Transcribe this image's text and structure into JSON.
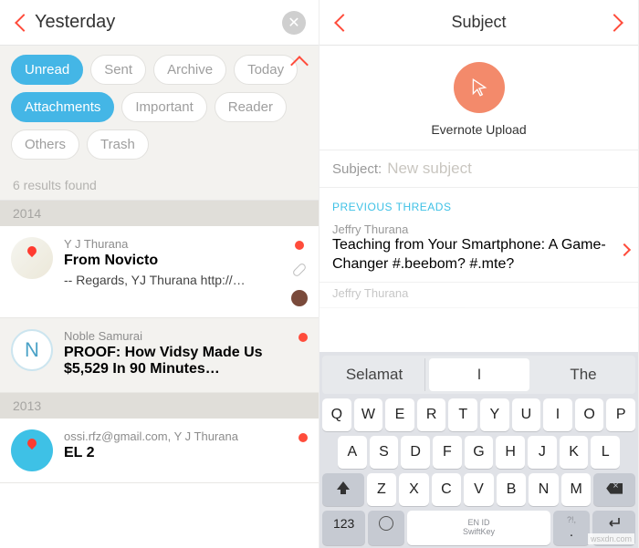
{
  "left": {
    "title": "Yesterday",
    "filters": [
      {
        "label": "Unread",
        "active": true
      },
      {
        "label": "Sent",
        "active": false
      },
      {
        "label": "Archive",
        "active": false
      },
      {
        "label": "Today",
        "active": false
      },
      {
        "label": "Attachments",
        "active": true
      },
      {
        "label": "Important",
        "active": false
      },
      {
        "label": "Reader",
        "active": false
      },
      {
        "label": "Others",
        "active": false
      },
      {
        "label": "Trash",
        "active": false
      }
    ],
    "results_text": "6 results found",
    "year1": "2014",
    "items": [
      {
        "sender": "Y J Thurana",
        "subject": "From Novicto",
        "preview": "-- Regards, YJ Thurana http://…"
      },
      {
        "sender": "Noble Samurai",
        "subject": "PROOF: How Vidsy Made Us $5,529 In 90 Minutes…",
        "preview": ""
      }
    ],
    "year2": "2013",
    "item3": {
      "sender": "ossi.rfz@gmail.com, Y J Thurana",
      "subject": "EL 2"
    }
  },
  "right": {
    "title": "Subject",
    "upload_label": "Evernote Upload",
    "subject_key": "Subject:",
    "subject_placeholder": "New subject",
    "section": "PREVIOUS THREADS",
    "threads": [
      {
        "sender": "Jeffry Thurana",
        "subject": "Teaching from Your Smartphone: A Game-Changer #.beebom? #.mte?"
      },
      {
        "sender": "Jeffry Thurana",
        "subject": ""
      }
    ],
    "suggestions": [
      "Selamat",
      "I",
      "The"
    ],
    "kbd_rows": {
      "r1": [
        "Q",
        "W",
        "E",
        "R",
        "T",
        "Y",
        "U",
        "I",
        "O",
        "P"
      ],
      "r2": [
        "A",
        "S",
        "D",
        "F",
        "G",
        "H",
        "J",
        "K",
        "L"
      ],
      "r3": [
        "Z",
        "X",
        "C",
        "V",
        "B",
        "N",
        "M"
      ]
    },
    "key_123": "123",
    "space_lang": "EN ID",
    "space_brand": "SwiftKey",
    "punct_top": "?!,",
    "punct_big": "."
  },
  "attribution": "wsxdn.com"
}
